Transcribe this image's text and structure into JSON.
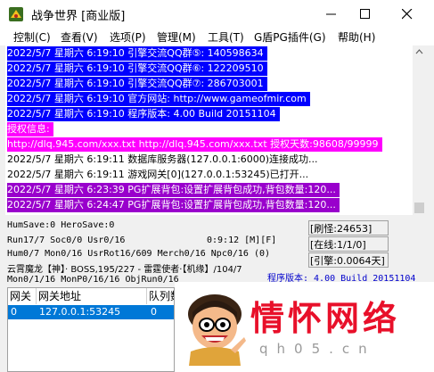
{
  "window": {
    "title": "战争世界 [商业版]",
    "controls": [
      "minimize-icon",
      "maximize-icon",
      "close-icon"
    ]
  },
  "menu": [
    {
      "label": "控制(C)"
    },
    {
      "label": "查看(V)"
    },
    {
      "label": "选项(P)"
    },
    {
      "label": "管理(M)"
    },
    {
      "label": "工具(T)"
    },
    {
      "label": "G盾PG插件(G)"
    },
    {
      "label": "帮助(H)"
    }
  ],
  "log": [
    {
      "text": "2022/5/7 星期六 6:19:10 引擎交流QQ群⑤: 140598634",
      "bg": "#0000ff",
      "fg": "#ffffff"
    },
    {
      "text": "2022/5/7 星期六 6:19:10 引擎交流QQ群⑥: 122209510",
      "bg": "#0000ff",
      "fg": "#ffffff"
    },
    {
      "text": "2022/5/7 星期六 6:19:10 引擎交流QQ群⑦: 286703001",
      "bg": "#0000ff",
      "fg": "#ffffff"
    },
    {
      "text": "2022/5/7 星期六 6:19:10 官方网站: http://www.gameofmir.com",
      "bg": "#0000ff",
      "fg": "#ffffff"
    },
    {
      "text": "2022/5/7 星期六 6:19:10 程序版本: 4.00 Build 20151104",
      "bg": "#0000ff",
      "fg": "#ffffff"
    },
    {
      "text": "授权信息:",
      "bg": "#ff00ff",
      "fg": "#ffffff"
    },
    {
      "text": "http://dlq.945.com/xxx.txt http://dlq.945.com/xxx.txt 授权天数:98608/99999",
      "bg": "#ff00ff",
      "fg": "#ffffff"
    },
    {
      "text": "2022/5/7 星期六 6:19:11 数据库服务器(127.0.0.1:6000)连接成功...",
      "bg": "#ffffff",
      "fg": "#000000"
    },
    {
      "text": "2022/5/7 星期六 6:19:11 游戏网关[0](127.0.0.1:53245)已打开...",
      "bg": "#ffffff",
      "fg": "#000000"
    },
    {
      "text": "2022/5/7 星期六 6:23:39 PG扩展背包:设置扩展背包成功,背包数量:120...",
      "bg": "#9900cc",
      "fg": "#ffffff"
    },
    {
      "text": "2022/5/7 星期六 6:24:47 PG扩展背包:设置扩展背包成功,背包数量:120...",
      "bg": "#9900cc",
      "fg": "#ffffff"
    }
  ],
  "status": {
    "line1": "HumSave:0 HeroSave:0",
    "line2": "Run17/7 Soc0/0 Usr0/16",
    "line2_time": "0:9:12 [M][F]",
    "line3": "Hum0/7 Mon0/16 UsrRot16/609 Merch0/16 Npc0/16 (0)",
    "line4": "云霄魔龙【神】· BOSS,195/227 - 雷霆使者·【机缘】/104/7",
    "line5": "Mon0/1/16 MonP0/16/16 ObjRun0/16",
    "brush": "[刷怪:24653]",
    "online": "[在线:1/1/0]",
    "engine": "[引擎:0.0064天]",
    "version": "程序版本: 4.00 Build 20151104"
  },
  "gateway_table": {
    "headers": [
      "网关",
      "网关地址",
      "队列数"
    ],
    "rows": [
      [
        "0",
        "127.0.0.1:53245",
        "0"
      ]
    ]
  },
  "watermark": {
    "title": "情怀网络",
    "sub": "qh05.cn"
  },
  "colors": {
    "blue": "#0000ff",
    "magenta": "#ff00ff",
    "purple": "#9900cc",
    "selection": "#0078d7"
  }
}
